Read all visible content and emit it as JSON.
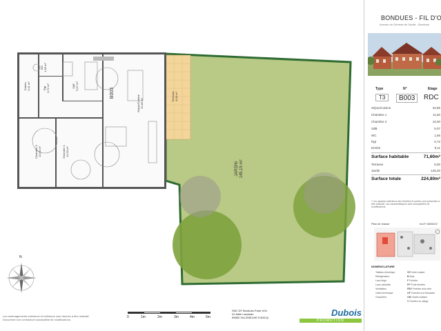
{
  "brand": {
    "title": "BONDUES - FIL D'OR",
    "subtitle": "Avenue du Général de Gaulle - Bondues",
    "accent": "#2a6b3a"
  },
  "lot": {
    "headers": [
      "Type",
      "N°",
      "Etage"
    ],
    "values": [
      "T3",
      "B003",
      "RDC"
    ]
  },
  "areas": [
    {
      "label": "Séjour/cuisine",
      "value": "32,85"
    },
    {
      "label": "Chambre 1",
      "value": "11,50"
    },
    {
      "label": "Chambre 2",
      "value": "10,00"
    },
    {
      "label": "SdB",
      "value": "5,07"
    },
    {
      "label": "WC",
      "value": "1,66"
    },
    {
      "label": "Rgt",
      "value": "0,72"
    },
    {
      "label": "Entrée",
      "value": "9,11"
    }
  ],
  "surface_habitable": {
    "label": "Surface habitable",
    "value": "71,60m²"
  },
  "outdoor": [
    {
      "label": "Terrasse",
      "value": "8,00"
    },
    {
      "label": "Jardin",
      "value": "145,20"
    }
  ],
  "surface_totale": {
    "label": "Surface totale",
    "value": "224,80m²"
  },
  "disclaimer": "* Les aspects extérieurs des fenêtres et portes sont présentés à titre indicatif. Les caractéristiques sont susceptibles de modifications.",
  "plan_title": "Plan de masse",
  "plan_ref": "Ind.F 08/03/22",
  "legend": {
    "title": "NOMENCLATURE",
    "left": [
      "Tableau électrique",
      "Réfrigérateur",
      "Lave-linge",
      "Lave-vaisselle",
      "Ventilation",
      "Gaine technique",
      "Chaudière"
    ],
    "codes": [
      {
        "code": "VR",
        "label": "Volet roulant"
      },
      {
        "code": "B",
        "label": "Bois"
      },
      {
        "code": "F",
        "label": "Fenêtre"
      },
      {
        "code": "PF",
        "label": "Porte-fenêtre"
      },
      {
        "code": "FBV",
        "label": "Fenêtre bois vitré"
      },
      {
        "code": "OF",
        "label": "Ouvrant à la française"
      },
      {
        "code": "OB",
        "label": "Oscillo-battant"
      },
      {
        "code": "V",
        "label": "Fenêtre en allège"
      }
    ]
  },
  "rooms": {
    "lot_id": "B003",
    "sejour": {
      "name": "Séjour/Cuisine",
      "area": "32,85 m²"
    },
    "terrasse": {
      "name": "Terrasse",
      "area": "8,00 m²"
    },
    "jardin": {
      "name": "JARDIN",
      "area": "145,15 m²"
    },
    "entree": {
      "name": "Entrée",
      "area": "9,11 m²"
    },
    "wc": {
      "name": "WC",
      "area": "1,66 m²"
    },
    "sdb": {
      "name": "SdB",
      "area": "5,07 m²"
    },
    "rgt": {
      "name": "Rgt",
      "area": "0,72 m²"
    },
    "chambre2": {
      "name": "Chambre 2",
      "area": "10,00 m²"
    },
    "chambre1": {
      "name": "Chambre 1",
      "area": "11,50 m²"
    }
  },
  "scale": {
    "labels": [
      "0",
      "1m",
      "2m",
      "3m",
      "4m",
      "5m"
    ]
  },
  "company": {
    "lines": [
      "SNC DF Bondues Porte d'Or",
      "31 Allée Lavoisier",
      "59650 VILLENEUVE D'ASCQ"
    ],
    "logo": "Dubois",
    "logo_sub": "PROMOTION"
  },
  "footer_note": "Les aménagements extérieurs et intérieurs sont donnés à titre indicatif. Document non contractuel susceptible de modifications.",
  "compass": {
    "label": "N"
  }
}
